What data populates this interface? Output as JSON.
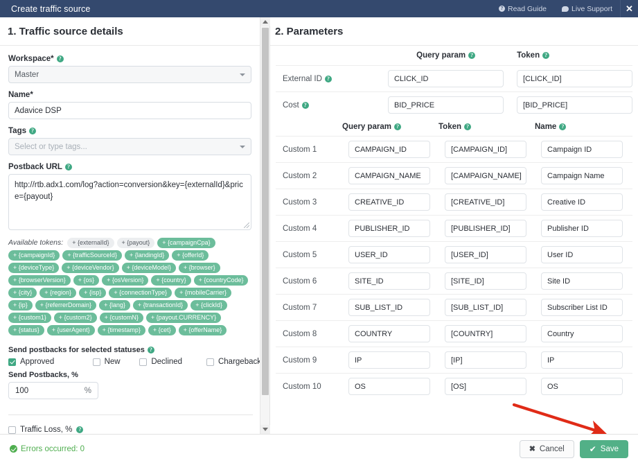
{
  "header": {
    "title": "Create traffic source",
    "read_guide": "Read Guide",
    "live_support": "Live Support",
    "close": "✕"
  },
  "left": {
    "heading": "1. Traffic source details",
    "workspace": {
      "label": "Workspace*",
      "value": "Master"
    },
    "name": {
      "label": "Name*",
      "value": "Adavice DSP"
    },
    "tags": {
      "label": "Tags",
      "placeholder": "Select or type tags..."
    },
    "postback_url": {
      "label": "Postback URL",
      "value": "http://rtb.adx1.com/log?action=conversion&key={externalId}&price={payout}"
    },
    "tokens_title": "Available tokens:",
    "tokens": [
      {
        "label": "+ {externalId}",
        "style": "grey"
      },
      {
        "label": "+ {payout}",
        "style": "grey"
      },
      {
        "label": "+ {campaignCpa}",
        "style": "green"
      },
      {
        "label": "+ {campaignId}",
        "style": "green"
      },
      {
        "label": "+ {trafficSourceId}",
        "style": "green"
      },
      {
        "label": "+ {landingId}",
        "style": "green"
      },
      {
        "label": "+ {offerId}",
        "style": "green"
      },
      {
        "label": "+ {deviceType}",
        "style": "green"
      },
      {
        "label": "+ {deviceVendor}",
        "style": "green"
      },
      {
        "label": "+ {deviceModel}",
        "style": "green"
      },
      {
        "label": "+ {browser}",
        "style": "green"
      },
      {
        "label": "+ {browserVersion}",
        "style": "green"
      },
      {
        "label": "+ {os}",
        "style": "green"
      },
      {
        "label": "+ {osVersion}",
        "style": "green"
      },
      {
        "label": "+ {country}",
        "style": "green"
      },
      {
        "label": "+ {countryCode}",
        "style": "green"
      },
      {
        "label": "+ {city}",
        "style": "green"
      },
      {
        "label": "+ {region}",
        "style": "green"
      },
      {
        "label": "+ {isp}",
        "style": "green"
      },
      {
        "label": "+ {connectionType}",
        "style": "green"
      },
      {
        "label": "+ {mobileCarrier}",
        "style": "green"
      },
      {
        "label": "+ {ip}",
        "style": "green"
      },
      {
        "label": "+ {referrerDomain}",
        "style": "green"
      },
      {
        "label": "+ {lang}",
        "style": "green"
      },
      {
        "label": "+ {transactionId}",
        "style": "green"
      },
      {
        "label": "+ {clickId}",
        "style": "green"
      },
      {
        "label": "+ {custom1}",
        "style": "green"
      },
      {
        "label": "+ {custom2}",
        "style": "green"
      },
      {
        "label": "+ {customN}",
        "style": "green"
      },
      {
        "label": "+ {payout.CURRENCY}",
        "style": "green"
      },
      {
        "label": "+ {status}",
        "style": "green"
      },
      {
        "label": "+ {userAgent}",
        "style": "green"
      },
      {
        "label": "+ {timestamp}",
        "style": "green"
      },
      {
        "label": "+ {cet}",
        "style": "green"
      },
      {
        "label": "+ {offerName}",
        "style": "green"
      }
    ],
    "statuses_title": "Send postbacks for selected statuses",
    "statuses": [
      {
        "label": "Approved",
        "checked": true
      },
      {
        "label": "New",
        "checked": false
      },
      {
        "label": "Declined",
        "checked": false
      },
      {
        "label": "Chargeback",
        "checked": false
      }
    ],
    "send_postbacks_pct": {
      "label": "Send Postbacks, %",
      "value": "100",
      "suffix": "%"
    },
    "traffic_loss": {
      "label": "Traffic Loss, %",
      "checked": false
    }
  },
  "right": {
    "heading": "2. Parameters",
    "top_headers": {
      "query_param": "Query param",
      "token": "Token"
    },
    "top_rows": [
      {
        "label": "External ID",
        "query_param": "CLICK_ID",
        "token": "[CLICK_ID]"
      },
      {
        "label": "Cost",
        "query_param": "BID_PRICE",
        "token": "[BID_PRICE]"
      }
    ],
    "custom_headers": {
      "query_param": "Query param",
      "token": "Token",
      "name": "Name"
    },
    "custom_rows": [
      {
        "label": "Custom 1",
        "query_param": "CAMPAIGN_ID",
        "token": "[CAMPAIGN_ID]",
        "name": "Campaign ID"
      },
      {
        "label": "Custom 2",
        "query_param": "CAMPAIGN_NAME",
        "token": "[CAMPAIGN_NAME]",
        "name": "Campaign Name"
      },
      {
        "label": "Custom 3",
        "query_param": "CREATIVE_ID",
        "token": "[CREATIVE_ID]",
        "name": "Creative ID"
      },
      {
        "label": "Custom 4",
        "query_param": "PUBLISHER_ID",
        "token": "[PUBLISHER_ID]",
        "name": "Publisher ID"
      },
      {
        "label": "Custom 5",
        "query_param": "USER_ID",
        "token": "[USER_ID]",
        "name": "User ID"
      },
      {
        "label": "Custom 6",
        "query_param": "SITE_ID",
        "token": "[SITE_ID]",
        "name": "Site ID"
      },
      {
        "label": "Custom 7",
        "query_param": "SUB_LIST_ID",
        "token": "[SUB_LIST_ID]",
        "name": "Subscriber List ID"
      },
      {
        "label": "Custom 8",
        "query_param": "COUNTRY",
        "token": "[COUNTRY]",
        "name": "Country"
      },
      {
        "label": "Custom 9",
        "query_param": "IP",
        "token": "[IP]",
        "name": "IP"
      },
      {
        "label": "Custom 10",
        "query_param": "OS",
        "token": "[OS]",
        "name": "OS"
      }
    ]
  },
  "footer": {
    "status": "Errors occurred: 0",
    "cancel": "Cancel",
    "save": "Save"
  },
  "colors": {
    "header_bg": "#34496e",
    "accent_green": "#3fa883",
    "token_green": "#6cbd9b",
    "save_green": "#52b087",
    "status_green": "#4fae4f",
    "annotation_red": "#e02b17"
  }
}
